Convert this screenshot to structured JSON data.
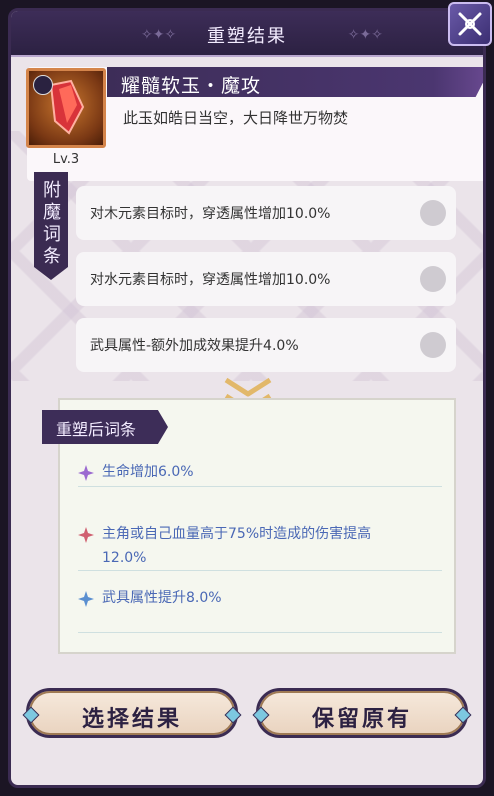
{
  "header": {
    "title": "重塑结果",
    "close_icon": "close-icon"
  },
  "item": {
    "name": "耀髓软玉・魔攻",
    "description": "此玉如皓日当空，大日降世万物焚",
    "level": "Lv.3",
    "icon": "red-jade-icon"
  },
  "enchant_tab": {
    "label": "附魔词条"
  },
  "affixes": [
    {
      "text": "对木元素目标时，穿透属性增加10.0%"
    },
    {
      "text": "对水元素目标时，穿透属性增加10.0%"
    },
    {
      "text": "武具属性-额外加成效果提升4.0%"
    }
  ],
  "result": {
    "tab_label": "重塑后词条",
    "entries": [
      {
        "text": "生命增加6.0%",
        "star_color": "#9b6ad0"
      },
      {
        "text": "主角或自己血量高于75%时造成的伤害提高12.0%",
        "star_color": "#d06070"
      },
      {
        "text": "武具属性提升8.0%",
        "star_color": "#5a8fd0"
      }
    ]
  },
  "buttons": {
    "select_label": "选择结果",
    "keep_label": "保留原有"
  }
}
